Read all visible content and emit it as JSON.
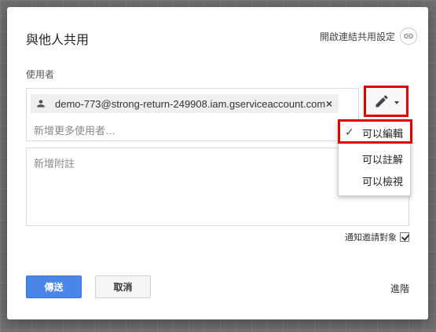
{
  "dialog": {
    "title": "與他人共用",
    "link_settings_label": "開啟連結共用設定",
    "people_label": "使用者",
    "collaborator_email": "demo-773@strong-return-249908.iam.gserviceaccount.com",
    "remove_chip": "×",
    "add_more_placeholder": "新增更多使用者…",
    "note_placeholder": "新增附註",
    "notify_label": "通知邀請對象",
    "notify_checked": true,
    "send_label": "傳送",
    "cancel_label": "取消",
    "advanced_label": "進階"
  },
  "permission_menu": {
    "selected": "可以編輯",
    "check_mark": "✓",
    "items": [
      {
        "label": "可以編輯"
      },
      {
        "label": "可以註解"
      },
      {
        "label": "可以檢視"
      }
    ]
  },
  "colors": {
    "send_button": "#4a86e8",
    "highlight_border": "#e00000"
  },
  "icons": {
    "link": "link-icon",
    "person": "person-icon",
    "pencil": "pencil-icon",
    "dropdown": "caret-down-icon",
    "check": "check-icon"
  }
}
